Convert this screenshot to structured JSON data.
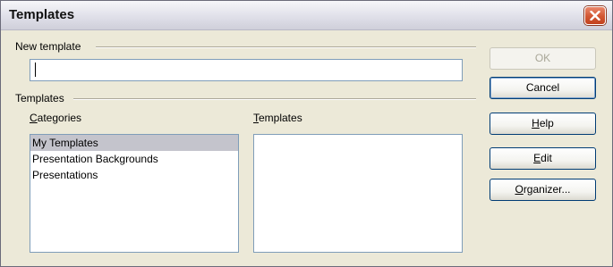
{
  "window": {
    "title": "Templates"
  },
  "new_template": {
    "section_label": "New template",
    "input_value": ""
  },
  "templates": {
    "section_label": "Templates",
    "categories_label": "Categories",
    "categories": [
      {
        "label": "My Templates",
        "selected": true
      },
      {
        "label": "Presentation Backgrounds",
        "selected": false
      },
      {
        "label": "Presentations",
        "selected": false
      }
    ],
    "templates_label": "Templates",
    "template_items": []
  },
  "buttons": {
    "ok": "OK",
    "cancel": "Cancel",
    "help": "Help",
    "edit": "Edit",
    "organizer": "Organizer..."
  },
  "icons": {
    "close": "close-icon"
  },
  "colors": {
    "close_button": "#d25632",
    "selection": "#c4c4cc",
    "dialog_background": "#ece9d8"
  }
}
